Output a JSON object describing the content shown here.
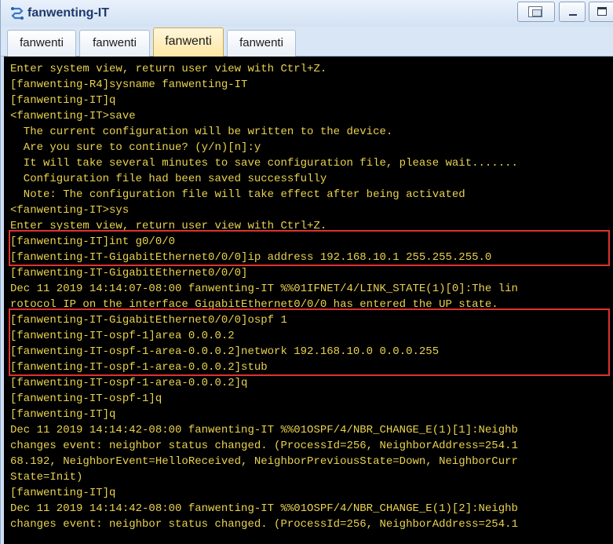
{
  "window": {
    "title": "fanwenting-IT",
    "icon": "network-app-icon"
  },
  "tabs": [
    {
      "label": "fanwenti",
      "active": false
    },
    {
      "label": "fanwenti",
      "active": false
    },
    {
      "label": "fanwenti",
      "active": true
    },
    {
      "label": "fanwenti",
      "active": false
    }
  ],
  "terminal": {
    "text_color": "#e9d24f",
    "background": "#000000",
    "lines": [
      "Enter system view, return user view with Ctrl+Z.",
      "[fanwenting-R4]sysname fanwenting-IT",
      "[fanwenting-IT]q",
      "<fanwenting-IT>save",
      "  The current configuration will be written to the device.",
      "  Are you sure to continue? (y/n)[n]:y",
      "  It will take several minutes to save configuration file, please wait.......",
      "  Configuration file had been saved successfully",
      "  Note: The configuration file will take effect after being activated",
      "<fanwenting-IT>sys",
      "Enter system view, return user view with Ctrl+Z.",
      "[fanwenting-IT]int g0/0/0",
      "[fanwenting-IT-GigabitEthernet0/0/0]ip address 192.168.10.1 255.255.255.0",
      "[fanwenting-IT-GigabitEthernet0/0/0]",
      "Dec 11 2019 14:14:07-08:00 fanwenting-IT %%01IFNET/4/LINK_STATE(1)[0]:The lin",
      "rotocol IP on the interface GigabitEthernet0/0/0 has entered the UP state.",
      "[fanwenting-IT-GigabitEthernet0/0/0]ospf 1",
      "[fanwenting-IT-ospf-1]area 0.0.0.2",
      "[fanwenting-IT-ospf-1-area-0.0.0.2]network 192.168.10.0 0.0.0.255",
      "[fanwenting-IT-ospf-1-area-0.0.0.2]stub",
      "[fanwenting-IT-ospf-1-area-0.0.0.2]q",
      "[fanwenting-IT-ospf-1]q",
      "[fanwenting-IT]q",
      "Dec 11 2019 14:14:42-08:00 fanwenting-IT %%01OSPF/4/NBR_CHANGE_E(1)[1]:Neighb",
      "changes event: neighbor status changed. (ProcessId=256, NeighborAddress=254.1",
      "68.192, NeighborEvent=HelloReceived, NeighborPreviousState=Down, NeighborCurr",
      "State=Init)",
      "[fanwenting-IT]q",
      "Dec 11 2019 14:14:42-08:00 fanwenting-IT %%01OSPF/4/NBR_CHANGE_E(1)[2]:Neighb",
      "changes event: neighbor status changed. (ProcessId=256, NeighborAddress=254.1"
    ]
  },
  "highlight_color": "#e0312f"
}
